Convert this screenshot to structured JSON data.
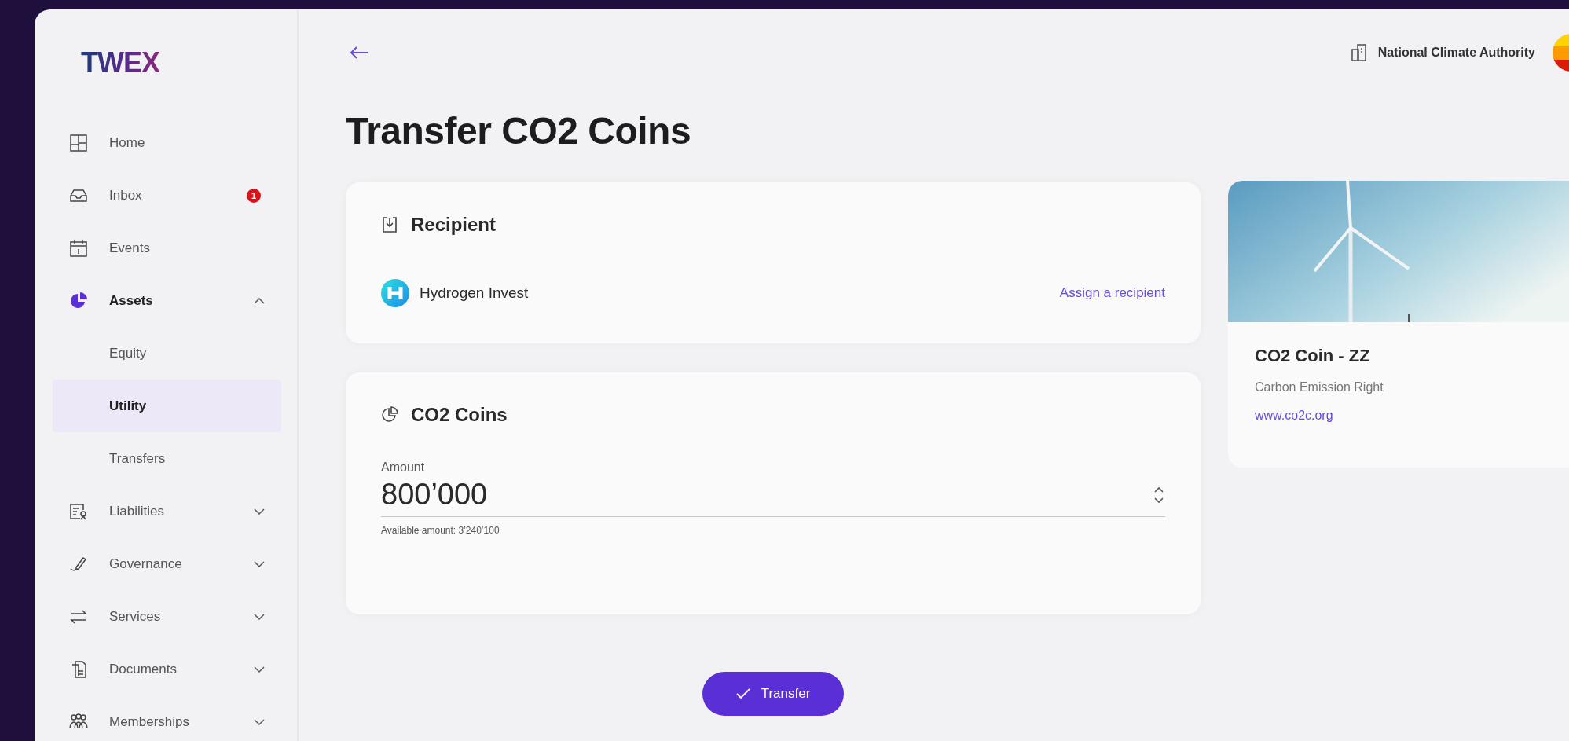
{
  "logo": {
    "text": "TWEX"
  },
  "sidebar": {
    "items": [
      {
        "label": "Home",
        "selected": false
      },
      {
        "label": "Inbox",
        "selected": false,
        "badge": "1"
      },
      {
        "label": "Events",
        "selected": false
      },
      {
        "label": "Assets",
        "selected": true,
        "expanded": true,
        "children": [
          {
            "label": "Equity",
            "selected": false
          },
          {
            "label": "Utility",
            "selected": true
          },
          {
            "label": "Transfers",
            "selected": false
          }
        ]
      },
      {
        "label": "Liabilities",
        "selected": false,
        "expanded": false
      },
      {
        "label": "Governance",
        "selected": false,
        "expanded": false
      },
      {
        "label": "Services",
        "selected": false,
        "expanded": false
      },
      {
        "label": "Documents",
        "selected": false,
        "expanded": false
      },
      {
        "label": "Memberships",
        "selected": false,
        "expanded": false
      }
    ]
  },
  "header": {
    "organization": "National Climate Authority"
  },
  "page": {
    "title": "Transfer CO2 Coins"
  },
  "recipient_card": {
    "title": "Recipient",
    "recipient": "Hydrogen Invest",
    "link": "Assign a recipient"
  },
  "coins_card": {
    "title": "CO2 Coins",
    "field_label": "Amount",
    "value": "800’000",
    "hint": "Available amount: 3’240’100"
  },
  "transfer_button": {
    "label": "Transfer"
  },
  "asset_card": {
    "name": "CO2 Coin - ZZ",
    "type": "Carbon Emission Right",
    "link": "www.co2c.org"
  }
}
